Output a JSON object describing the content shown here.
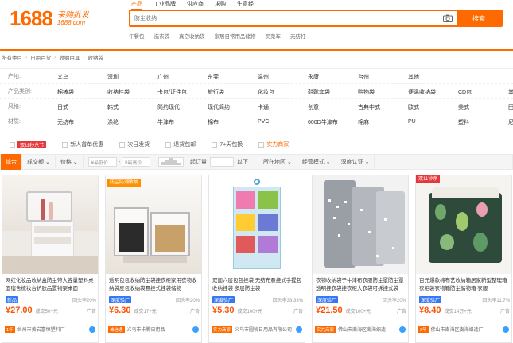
{
  "logo": {
    "number": "1688",
    "cn": "采购批发",
    "url": "1688.com"
  },
  "search": {
    "tabs": [
      "产品",
      "工业品牌",
      "供应商",
      "求购",
      "生意经"
    ],
    "placeholder": "防尘收纳",
    "button": "搜索",
    "hotwords": [
      "午餐包",
      "洗衣袋",
      "真空收纳袋",
      "家居日常用品储物",
      "买菜车",
      "无纺打"
    ]
  },
  "breadcrumb": [
    "所有类目",
    "日用百货",
    "收纳用具",
    "收纳袋"
  ],
  "filters": [
    {
      "label": "产地:",
      "values": [
        "义乌",
        "深圳",
        "广州",
        "东莞",
        "温州",
        "永康",
        "台州",
        "其他"
      ]
    },
    {
      "label": "产品类别:",
      "values": [
        "棉被袋",
        "收纳挂袋",
        "卡包/证件包",
        "旅行袋",
        "化妆包",
        "鞋靴套袋",
        "购物袋",
        "便温收纳袋",
        "CD包",
        "其他"
      ]
    },
    {
      "label": "风格:",
      "values": [
        "日式",
        "韩式",
        "简约现代",
        "现代简约",
        "卡通",
        "创意",
        "古典中式",
        "欧式",
        "美式",
        "田园"
      ]
    },
    {
      "label": "材质:",
      "values": [
        "无纺布",
        "涤纶",
        "牛津布",
        "棉布",
        "PVC",
        "600D牛津布",
        "棉麻",
        "PU",
        "塑料",
        "尼龙"
      ]
    }
  ],
  "services": {
    "tag": "双11秒杀节",
    "items": [
      "新人首单优惠",
      "次日发货",
      "退货包邮",
      "7+天包换",
      "实力商家"
    ]
  },
  "sortbar": {
    "items": [
      "综合",
      "成交额",
      "价格"
    ],
    "price_min": "¥最低价",
    "dash": "-",
    "price_max": "¥最高价",
    "moq_label": "起订量",
    "moq_unit": "以下",
    "region": "所在地区",
    "mode": "经营模式",
    "cert": "深度认证"
  },
  "products": [
    {
      "title": "网红化妆品收纳盒防尘带大容量塑料桌面宿舍梳妆台护肤品置物架桌面",
      "badge": "新品",
      "repurchase": "回头率20%",
      "price": "¥27.00",
      "sold": "成交50+元",
      "ad": "广告",
      "shop_tag": "1年",
      "shop": "台州市黄岩富恒塑料厂",
      "corner": ""
    },
    {
      "title": "透明包包收纳防尘袋挂衣柜家用衣物收纳袋皮包收纳袋悬挂式挂袋储物",
      "badge": "深度验厂",
      "repurchase": "回头率20%",
      "price": "¥6.30",
      "sold": "成交17+元",
      "ad": "广告",
      "shop_tag": "诚信通",
      "shop": "义乌市卡腾日用品",
      "corner": "防尘防潮收纳"
    },
    {
      "title": "双面六层包包挂袋 无纺布悬挂式手提包收纳挂袋 多层防尘袋",
      "badge": "深度验厂",
      "repurchase": "回头率33.33%",
      "price": "¥5.30",
      "sold": "成交100+元",
      "ad": "广告",
      "shop_tag": "实力商家",
      "shop": "义乌市圆锐日用品有限公司",
      "corner": ""
    },
    {
      "title": "衣物收纳袋子牛津布衣服防尘罩防尘罩透明挂衣袋挂衣柜大衣袋可拆挂式袋",
      "badge": "深度验厂",
      "repurchase": "回头率20%",
      "price": "¥21.50",
      "sold": "成交100+元",
      "ad": "广告",
      "shop_tag": "实力商家",
      "shop": "佛山市南海区南海织造",
      "corner": ""
    },
    {
      "title": "百元爆款棉布艺收纳箱居家新型整理箱衣柜装衣物箱防尘储物箱 衣服",
      "badge": "深度验厂",
      "repurchase": "回头率11.7%",
      "price": "¥8.40",
      "sold": "成交14万+元",
      "ad": "广告",
      "shop_tag": "3年",
      "shop": "佛山市南海区南海织造厂",
      "corner": "双11秒杀"
    }
  ],
  "colors": {
    "brand": "#ff6a00",
    "price": "#ff5000"
  }
}
